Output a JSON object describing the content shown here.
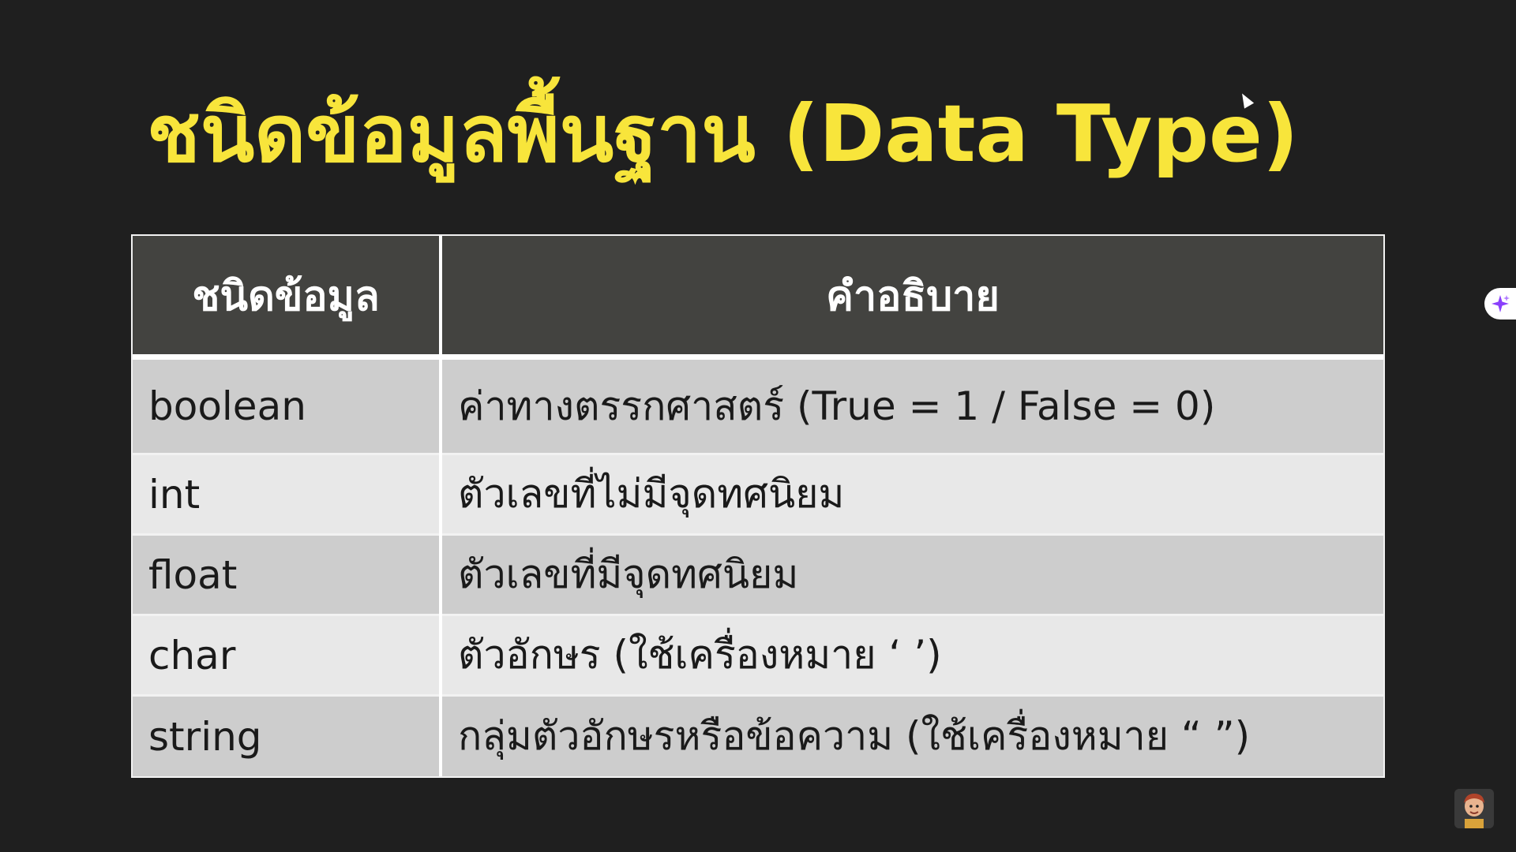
{
  "slide": {
    "title": "ชนิดข้อมูลพื้นฐาน (Data Type)"
  },
  "table": {
    "headers": [
      "ชนิดข้อมูล",
      "คำอธิบาย"
    ],
    "rows": [
      {
        "type": "boolean",
        "description": "ค่าทางตรรกศาสตร์ (True = 1 / False = 0)"
      },
      {
        "type": "int",
        "description": "ตัวเลขที่ไม่มีจุดทศนิยม"
      },
      {
        "type": "float",
        "description": "ตัวเลขที่มีจุดทศนิยม"
      },
      {
        "type": "char",
        "description": "ตัวอักษร (ใช้เครื่องหมาย ‘ ’)"
      },
      {
        "type": "string",
        "description": "กลุ่มตัวอักษรหรือข้อความ (ใช้เครื่องหมาย “ ”)"
      }
    ]
  },
  "colors": {
    "background": "#1f1f1f",
    "title": "#f8e53b",
    "header_bg": "#434340",
    "row_dark": "#cdcdcd",
    "row_light": "#e8e8e8",
    "ai_badge_accent": "#8a3ffc"
  },
  "icons": {
    "cursor": "mouse-pointer-icon",
    "ai_badge": "sparkle-icon",
    "avatar": "presenter-avatar-icon"
  }
}
